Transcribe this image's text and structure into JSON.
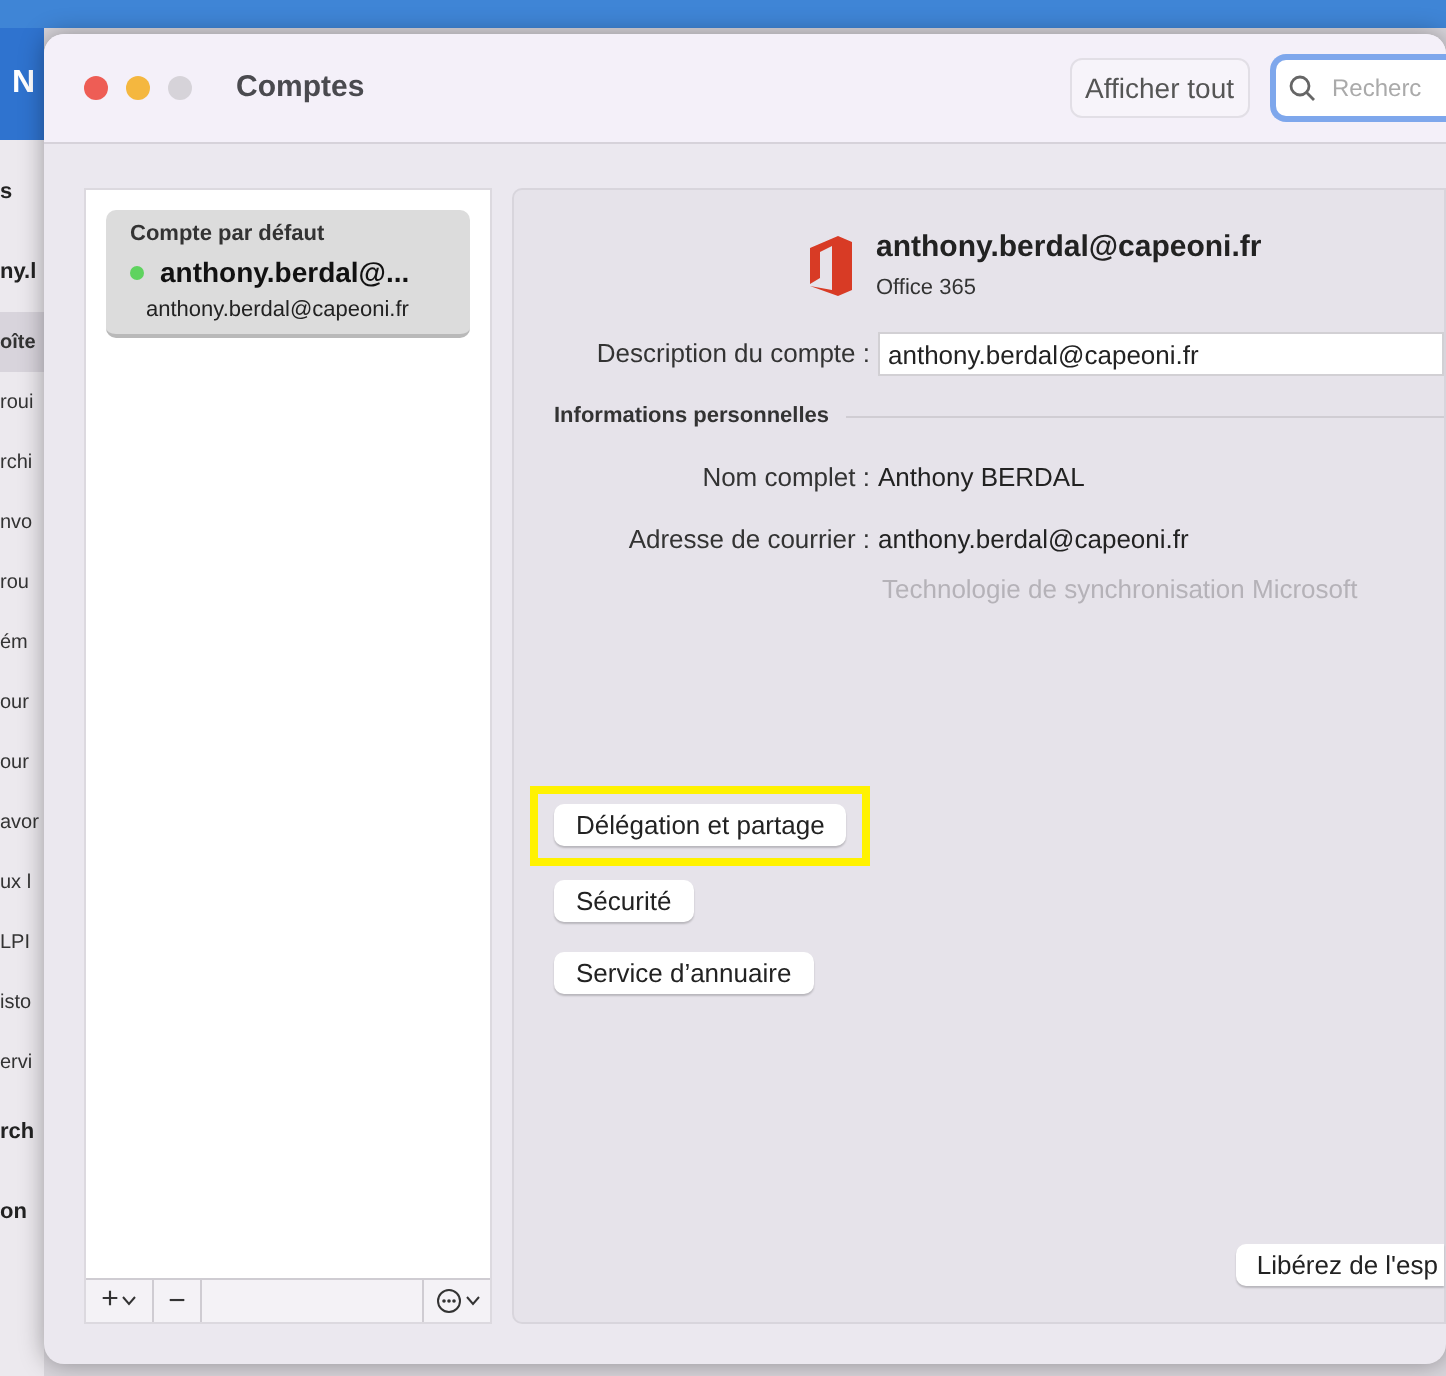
{
  "background_app": {
    "toolbar_label": "N",
    "sidebar_items": [
      {
        "label": "s",
        "kind": "header",
        "selected": false
      },
      {
        "label": "ny.l",
        "kind": "header",
        "selected": false
      },
      {
        "label": "oîte",
        "kind": "item",
        "selected": true
      },
      {
        "label": "roui",
        "kind": "item",
        "selected": false
      },
      {
        "label": "rchi",
        "kind": "item",
        "selected": false
      },
      {
        "label": "nvo",
        "kind": "item",
        "selected": false
      },
      {
        "label": "rou",
        "kind": "item",
        "selected": false
      },
      {
        "label": "ém",
        "kind": "item",
        "selected": false
      },
      {
        "label": "our",
        "kind": "item",
        "selected": false
      },
      {
        "label": "our",
        "kind": "item",
        "selected": false
      },
      {
        "label": "avor",
        "kind": "item",
        "selected": false
      },
      {
        "label": "ux l",
        "kind": "item",
        "selected": false
      },
      {
        "label": "LPI",
        "kind": "item",
        "selected": false
      },
      {
        "label": "isto",
        "kind": "item",
        "selected": false
      },
      {
        "label": "ervi",
        "kind": "item",
        "selected": false
      },
      {
        "label": "rch",
        "kind": "header",
        "selected": false
      },
      {
        "label": "on",
        "kind": "header",
        "selected": false
      }
    ]
  },
  "window": {
    "title": "Comptes",
    "show_all_button": "Afficher tout",
    "search": {
      "placeholder": "Recherc"
    }
  },
  "accounts": [
    {
      "group": "Compte par défaut",
      "name": "anthony.berdal@...",
      "email": "anthony.berdal@capeoni.fr",
      "online": true,
      "selected": true
    }
  ],
  "account_list_toolbar": {
    "add": "+",
    "remove": "−"
  },
  "detail": {
    "email": "anthony.berdal@capeoni.fr",
    "type": "Office 365",
    "description_label": "Description du compte :",
    "description_value": "anthony.berdal@capeoni.fr",
    "section_title": "Informations personnelles",
    "fields": [
      {
        "label": "Nom complet :",
        "value": "Anthony BERDAL"
      },
      {
        "label": "Adresse de courrier :",
        "value": "anthony.berdal@capeoni.fr"
      }
    ],
    "sync_note": "Technologie de synchronisation Microsoft",
    "buttons": [
      {
        "label": "Délégation et partage",
        "highlighted": true
      },
      {
        "label": "Sécurité",
        "highlighted": false
      },
      {
        "label": "Service d’annuaire",
        "highlighted": false
      }
    ],
    "free_space_button": "Libérez de l'esp"
  }
}
